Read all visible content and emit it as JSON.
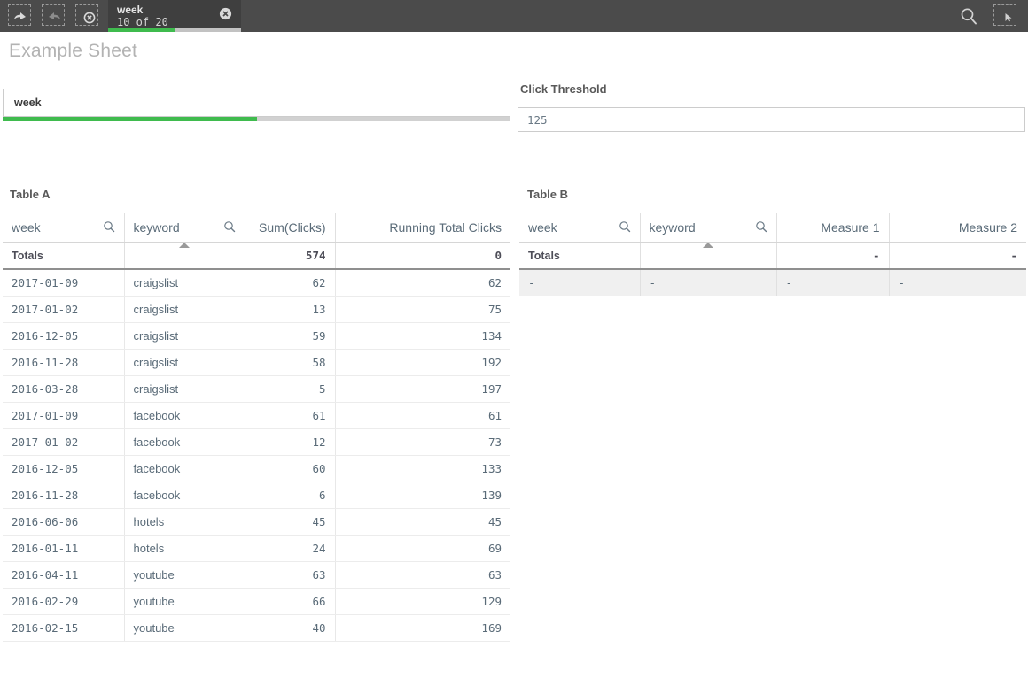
{
  "toolbar": {
    "icons": [
      {
        "name": "undo-icon",
        "label": "Undo"
      },
      {
        "name": "redo-icon",
        "label": "Redo"
      },
      {
        "name": "clear-selections-icon",
        "label": "Clear all selections"
      }
    ],
    "selection_tab": {
      "field": "week",
      "count_text": "10 of 20",
      "selected_fraction": 0.5,
      "clear_icon": "close-circle-icon",
      "bar_color": "#3fbb4e"
    },
    "right_icons": [
      {
        "name": "search-icon",
        "label": "Smart search"
      },
      {
        "name": "selections-tool-icon",
        "label": "Selections tool"
      }
    ]
  },
  "sheet": {
    "title": "Example Sheet"
  },
  "filter_pane": {
    "name": "week",
    "progress_fraction": 0.5,
    "progress_color": "#3fbb4e"
  },
  "variable_input": {
    "label": "Click Threshold",
    "value": "125",
    "placeholder": "125"
  },
  "table_a": {
    "title": "Table A",
    "columns": [
      {
        "label": "week",
        "type": "dim",
        "search": true,
        "sorted": false
      },
      {
        "label": "keyword",
        "type": "dim",
        "search": true,
        "sorted": true
      },
      {
        "label": "Sum(Clicks)",
        "type": "meas",
        "search": false,
        "sorted": false
      },
      {
        "label": "Running Total Clicks",
        "type": "meas",
        "search": false,
        "sorted": false
      }
    ],
    "totals": {
      "label": "Totals",
      "keyword": "",
      "sum_clicks": "574",
      "running_total": "0"
    },
    "rows": [
      {
        "week": "2017-01-09",
        "keyword": "craigslist",
        "clicks": "62",
        "running": "62"
      },
      {
        "week": "2017-01-02",
        "keyword": "craigslist",
        "clicks": "13",
        "running": "75"
      },
      {
        "week": "2016-12-05",
        "keyword": "craigslist",
        "clicks": "59",
        "running": "134"
      },
      {
        "week": "2016-11-28",
        "keyword": "craigslist",
        "clicks": "58",
        "running": "192"
      },
      {
        "week": "2016-03-28",
        "keyword": "craigslist",
        "clicks": "5",
        "running": "197"
      },
      {
        "week": "2017-01-09",
        "keyword": "facebook",
        "clicks": "61",
        "running": "61"
      },
      {
        "week": "2017-01-02",
        "keyword": "facebook",
        "clicks": "12",
        "running": "73"
      },
      {
        "week": "2016-12-05",
        "keyword": "facebook",
        "clicks": "60",
        "running": "133"
      },
      {
        "week": "2016-11-28",
        "keyword": "facebook",
        "clicks": "6",
        "running": "139"
      },
      {
        "week": "2016-06-06",
        "keyword": "hotels",
        "clicks": "45",
        "running": "45"
      },
      {
        "week": "2016-01-11",
        "keyword": "hotels",
        "clicks": "24",
        "running": "69"
      },
      {
        "week": "2016-04-11",
        "keyword": "youtube",
        "clicks": "63",
        "running": "63"
      },
      {
        "week": "2016-02-29",
        "keyword": "youtube",
        "clicks": "66",
        "running": "129"
      },
      {
        "week": "2016-02-15",
        "keyword": "youtube",
        "clicks": "40",
        "running": "169"
      }
    ]
  },
  "table_b": {
    "title": "Table B",
    "columns": [
      {
        "label": "week",
        "type": "dim",
        "search": true,
        "sorted": false
      },
      {
        "label": "keyword",
        "type": "dim",
        "search": true,
        "sorted": true
      },
      {
        "label": "Measure 1",
        "type": "meas",
        "search": false,
        "sorted": false
      },
      {
        "label": "Measure 2",
        "type": "meas",
        "search": false,
        "sorted": false
      }
    ],
    "totals": {
      "label": "Totals",
      "keyword": "",
      "measure1": "-",
      "measure2": "-"
    },
    "rows": [
      {
        "week": "-",
        "keyword": "-",
        "measure1": "-",
        "measure2": "-"
      }
    ]
  }
}
